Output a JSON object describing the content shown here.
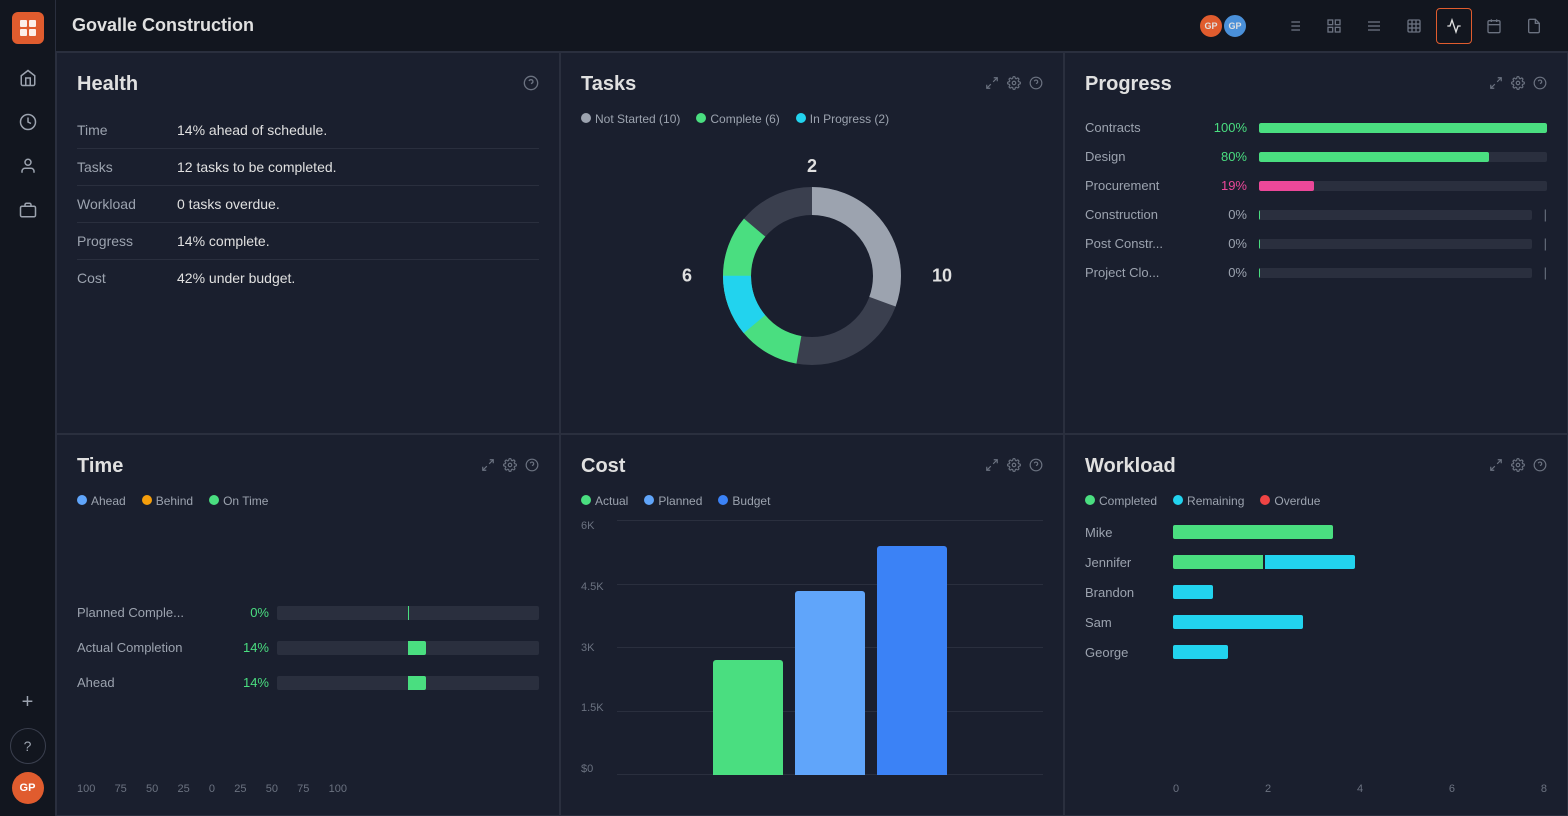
{
  "app": {
    "logo": "PM",
    "title": "Govalle Construction"
  },
  "topbar": {
    "title": "Govalle Construction",
    "avatars": [
      {
        "initials": "GP",
        "color": "#e05c2e"
      },
      {
        "initials": "GP",
        "color": "#4a90d9"
      }
    ],
    "nav_buttons": [
      {
        "icon": "≡",
        "label": "list-view",
        "active": false
      },
      {
        "icon": "⣿",
        "label": "board-view",
        "active": false
      },
      {
        "icon": "≡",
        "label": "table-view",
        "active": false
      },
      {
        "icon": "▦",
        "label": "grid-view",
        "active": false
      },
      {
        "icon": "∿",
        "label": "dashboard-view",
        "active": true
      },
      {
        "icon": "📅",
        "label": "calendar-view",
        "active": false
      },
      {
        "icon": "📄",
        "label": "doc-view",
        "active": false
      }
    ]
  },
  "sidebar": {
    "items": [
      {
        "icon": "⌂",
        "label": "home",
        "active": false
      },
      {
        "icon": "◷",
        "label": "recent",
        "active": false
      },
      {
        "icon": "👤",
        "label": "people",
        "active": false
      },
      {
        "icon": "💼",
        "label": "portfolio",
        "active": false
      }
    ],
    "bottom": [
      {
        "icon": "+",
        "label": "add"
      },
      {
        "icon": "?",
        "label": "help"
      },
      {
        "initials": "GP",
        "label": "profile",
        "color": "#e05c2e"
      }
    ]
  },
  "health": {
    "title": "Health",
    "rows": [
      {
        "label": "Time",
        "value": "14% ahead of schedule."
      },
      {
        "label": "Tasks",
        "value": "12 tasks to be completed."
      },
      {
        "label": "Workload",
        "value": "0 tasks overdue."
      },
      {
        "label": "Progress",
        "value": "14% complete."
      },
      {
        "label": "Cost",
        "value": "42% under budget."
      }
    ]
  },
  "tasks": {
    "title": "Tasks",
    "legend": [
      {
        "label": "Not Started (10)",
        "color": "#9ca3af"
      },
      {
        "label": "Complete (6)",
        "color": "#4ade80"
      },
      {
        "label": "In Progress (2)",
        "color": "#22d3ee"
      }
    ],
    "donut": {
      "not_started": 10,
      "complete": 6,
      "in_progress": 2,
      "label_left": "6",
      "label_right": "10",
      "label_top": "2"
    }
  },
  "progress": {
    "title": "Progress",
    "rows": [
      {
        "name": "Contracts",
        "pct": "100%",
        "pct_num": 100,
        "color": "#4ade80"
      },
      {
        "name": "Design",
        "pct": "80%",
        "pct_num": 80,
        "color": "#4ade80"
      },
      {
        "name": "Procurement",
        "pct": "19%",
        "pct_num": 19,
        "color": "#ec4899"
      },
      {
        "name": "Construction",
        "pct": "0%",
        "pct_num": 0,
        "color": "#4ade80"
      },
      {
        "name": "Post Constr...",
        "pct": "0%",
        "pct_num": 0,
        "color": "#4ade80"
      },
      {
        "name": "Project Clo...",
        "pct": "0%",
        "pct_num": 0,
        "color": "#4ade80"
      }
    ]
  },
  "time": {
    "title": "Time",
    "legend": [
      {
        "label": "Ahead",
        "color": "#60a5fa"
      },
      {
        "label": "Behind",
        "color": "#f59e0b"
      },
      {
        "label": "On Time",
        "color": "#4ade80"
      }
    ],
    "rows": [
      {
        "label": "Planned Comple...",
        "pct_label": "0%",
        "pct": 0,
        "color": "#4ade80"
      },
      {
        "label": "Actual Completion",
        "pct_label": "14%",
        "pct": 14,
        "color": "#4ade80"
      },
      {
        "label": "Ahead",
        "pct_label": "14%",
        "pct": 14,
        "color": "#4ade80"
      }
    ],
    "axis": [
      "100",
      "75",
      "50",
      "25",
      "0",
      "25",
      "50",
      "75",
      "100"
    ]
  },
  "cost": {
    "title": "Cost",
    "legend": [
      {
        "label": "Actual",
        "color": "#4ade80"
      },
      {
        "label": "Planned",
        "color": "#60a5fa"
      },
      {
        "label": "Budget",
        "color": "#3b82f6"
      }
    ],
    "y_labels": [
      "6K",
      "4.5K",
      "3K",
      "1.5K",
      "$0"
    ],
    "bars": [
      {
        "label": "Actual",
        "height_pct": 45,
        "color": "#4ade80"
      },
      {
        "label": "Planned",
        "height_pct": 72,
        "color": "#60a5fa"
      },
      {
        "label": "Budget",
        "height_pct": 90,
        "color": "#3b82f6"
      }
    ]
  },
  "workload": {
    "title": "Workload",
    "legend": [
      {
        "label": "Completed",
        "color": "#4ade80"
      },
      {
        "label": "Remaining",
        "color": "#22d3ee"
      },
      {
        "label": "Overdue",
        "color": "#ef4444"
      }
    ],
    "rows": [
      {
        "name": "Mike",
        "completed": 85,
        "remaining": 0,
        "overdue": 0
      },
      {
        "name": "Jennifer",
        "completed": 45,
        "remaining": 45,
        "overdue": 0
      },
      {
        "name": "Brandon",
        "completed": 0,
        "remaining": 25,
        "overdue": 0
      },
      {
        "name": "Sam",
        "completed": 0,
        "remaining": 60,
        "overdue": 0
      },
      {
        "name": "George",
        "completed": 0,
        "remaining": 28,
        "overdue": 0
      }
    ],
    "x_axis": [
      "0",
      "2",
      "4",
      "6",
      "8"
    ]
  }
}
